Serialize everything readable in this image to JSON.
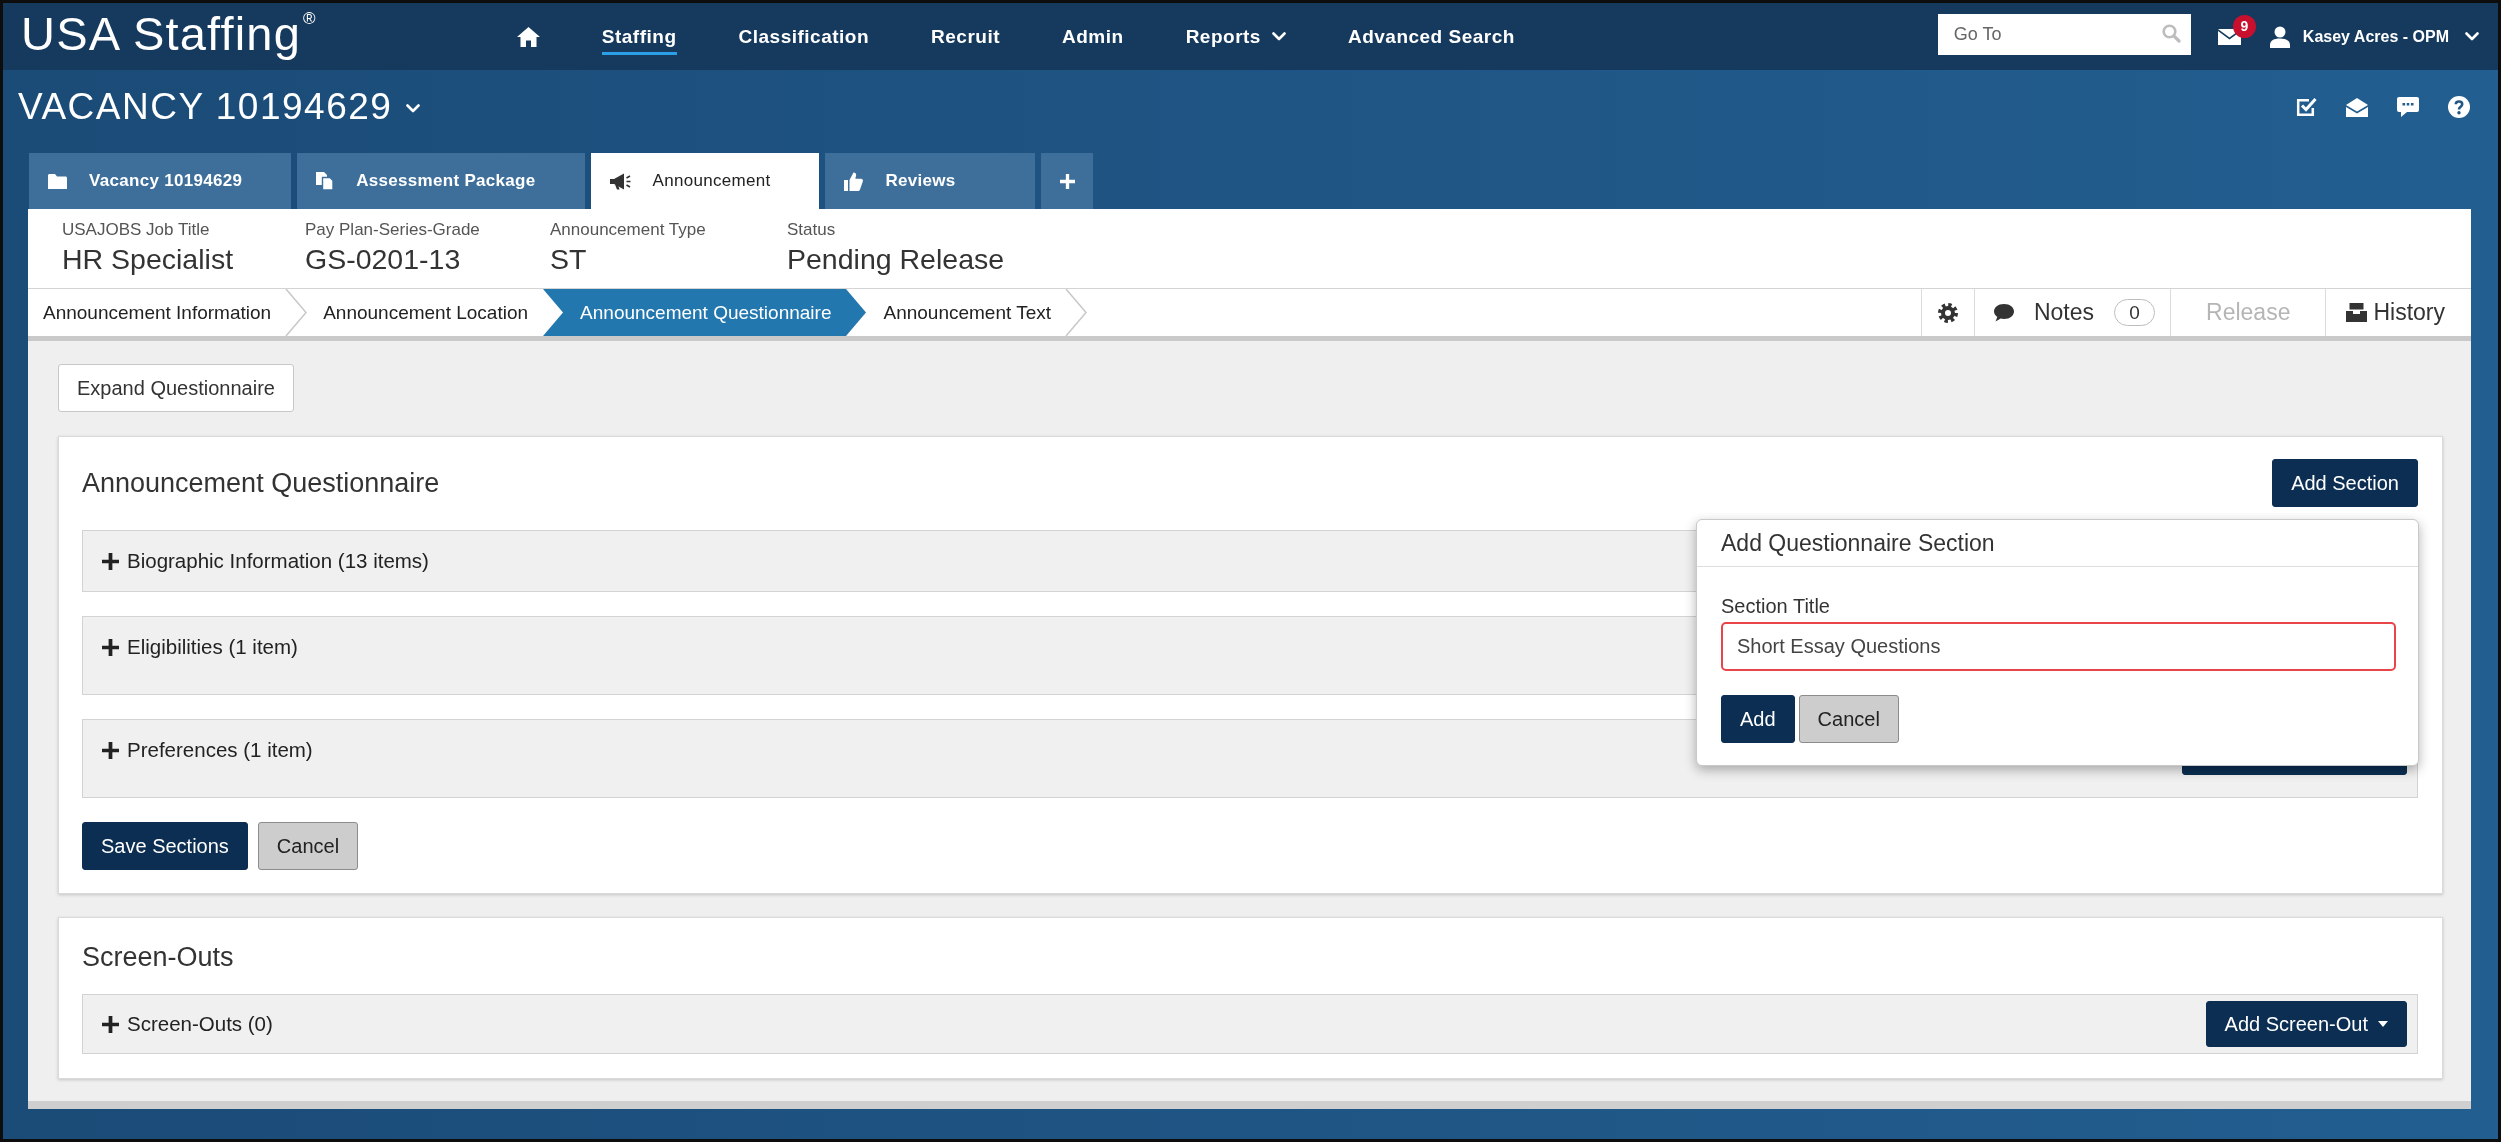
{
  "top_nav": {
    "logo": "USA Staffing$^{®}$",
    "items": [
      {
        "label": "Staffing",
        "selected": true,
        "dropdown": false
      },
      {
        "label": "Classification",
        "selected": false,
        "dropdown": false
      },
      {
        "label": "Recruit",
        "selected": false,
        "dropdown": false
      },
      {
        "label": "Admin",
        "selected": false,
        "dropdown": false
      },
      {
        "label": "Reports",
        "selected": false,
        "dropdown": true
      },
      {
        "label": "Advanced Search",
        "selected": false,
        "dropdown": false
      }
    ],
    "search": {
      "placeholder": "Go To"
    },
    "mail_badge": "9",
    "user": "Kasey Acres - OPM"
  },
  "vacancy": {
    "title": "VACANCY 10194629",
    "tabs": [
      {
        "label": "Vacancy 10194629",
        "selected": false
      },
      {
        "label": "Assessment Package",
        "selected": false
      },
      {
        "label": "Announcement",
        "selected": true
      },
      {
        "label": "Reviews",
        "selected": false
      }
    ]
  },
  "summary": [
    {
      "label": "USAJOBS Job Title",
      "value": "HR Specialist"
    },
    {
      "label": "Pay Plan-Series-Grade",
      "value": "GS-0201-13"
    },
    {
      "label": "Announcement Type",
      "value": "ST"
    },
    {
      "label": "Status",
      "value": "Pending Release"
    }
  ],
  "steps": [
    {
      "label": "Announcement Information",
      "selected": false
    },
    {
      "label": "Announcement Location",
      "selected": false
    },
    {
      "label": "Announcement Questionnaire",
      "selected": true
    },
    {
      "label": "Announcement Text",
      "selected": false
    }
  ],
  "step_actions": [
    {
      "kind": "settings",
      "disabled": false
    },
    {
      "kind": "notes",
      "label": "Notes",
      "count": "0",
      "disabled": false
    },
    {
      "kind": "release",
      "label": "Release",
      "disabled": true
    },
    {
      "kind": "history",
      "label": "History",
      "disabled": false
    }
  ],
  "expand_button": "Expand Questionnaire",
  "questionnaire": {
    "title": "Announcement Questionnaire",
    "add_button": "Add Section",
    "sections": [
      {
        "label": "Biographic Information (13 items)",
        "expanded": false,
        "has_button": false
      },
      {
        "label": "Eligibilities (1 item)",
        "expanded": false,
        "has_button": false
      },
      {
        "label": "Preferences (1 item)",
        "expanded": false,
        "has_button": true
      }
    ],
    "save_button": "Save Sections",
    "cancel_button": "Cancel"
  },
  "popover": {
    "title": "Add Questionnaire Section",
    "field_label": "Section Title",
    "value": "Short Essay Questions",
    "invalid": true,
    "add_button": "Add",
    "cancel_button": "Cancel"
  },
  "screen_outs": {
    "title": "Screen-Outs",
    "sections": [
      {
        "label": "Screen-Outs (0)",
        "expanded": false
      }
    ],
    "add_button": "Add Screen-Out"
  }
}
